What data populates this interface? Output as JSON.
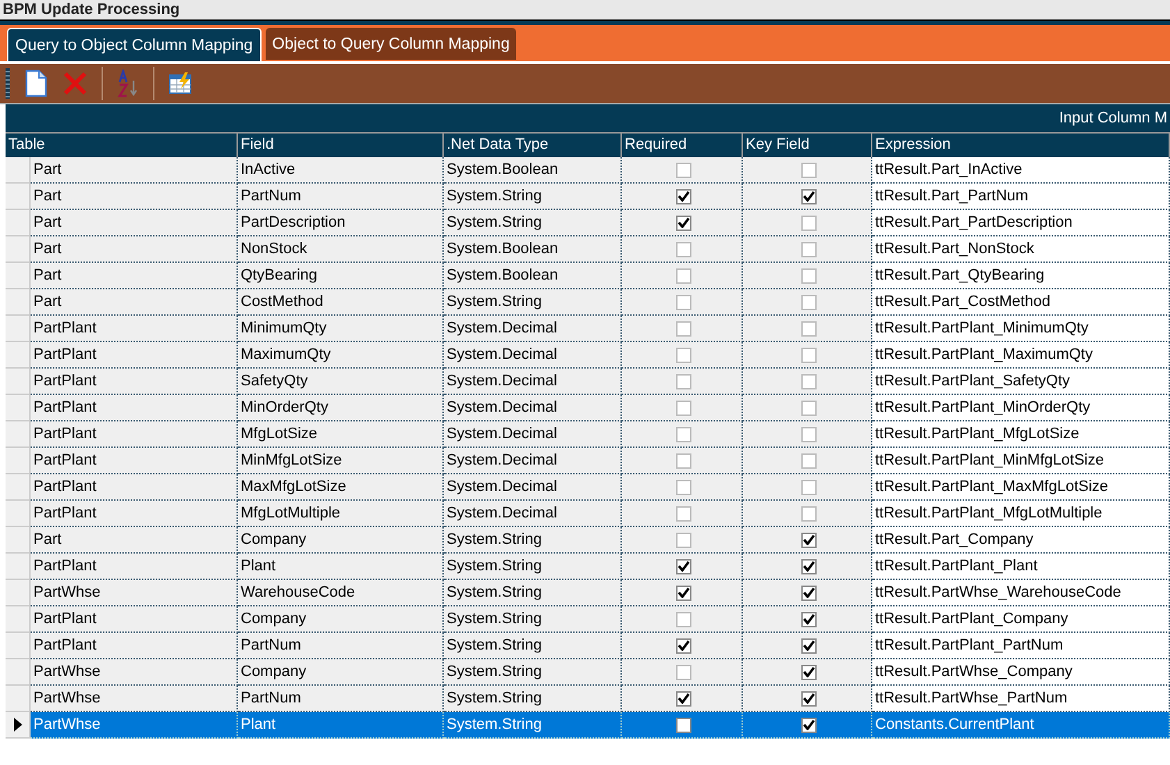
{
  "window": {
    "title": "BPM Update Processing"
  },
  "tabs": [
    {
      "label": "Query to Object Column Mapping",
      "selected": true
    },
    {
      "label": "Object to Query Column Mapping",
      "selected": false
    }
  ],
  "grid": {
    "group_header": "Input Column M",
    "columns": [
      "Table",
      "Field",
      ".Net Data Type",
      "Required",
      "Key Field",
      "Expression"
    ],
    "rows": [
      {
        "table": "Part",
        "field": "InActive",
        "type": "System.Boolean",
        "required": false,
        "key": false,
        "expression": "ttResult.Part_InActive",
        "selected": false
      },
      {
        "table": "Part",
        "field": "PartNum",
        "type": "System.String",
        "required": true,
        "key": true,
        "expression": "ttResult.Part_PartNum",
        "selected": false
      },
      {
        "table": "Part",
        "field": "PartDescription",
        "type": "System.String",
        "required": true,
        "key": false,
        "expression": "ttResult.Part_PartDescription",
        "selected": false
      },
      {
        "table": "Part",
        "field": "NonStock",
        "type": "System.Boolean",
        "required": false,
        "key": false,
        "expression": "ttResult.Part_NonStock",
        "selected": false
      },
      {
        "table": "Part",
        "field": "QtyBearing",
        "type": "System.Boolean",
        "required": false,
        "key": false,
        "expression": "ttResult.Part_QtyBearing",
        "selected": false
      },
      {
        "table": "Part",
        "field": "CostMethod",
        "type": "System.String",
        "required": false,
        "key": false,
        "expression": "ttResult.Part_CostMethod",
        "selected": false
      },
      {
        "table": "PartPlant",
        "field": "MinimumQty",
        "type": "System.Decimal",
        "required": false,
        "key": false,
        "expression": "ttResult.PartPlant_MinimumQty",
        "selected": false
      },
      {
        "table": "PartPlant",
        "field": "MaximumQty",
        "type": "System.Decimal",
        "required": false,
        "key": false,
        "expression": "ttResult.PartPlant_MaximumQty",
        "selected": false
      },
      {
        "table": "PartPlant",
        "field": "SafetyQty",
        "type": "System.Decimal",
        "required": false,
        "key": false,
        "expression": "ttResult.PartPlant_SafetyQty",
        "selected": false
      },
      {
        "table": "PartPlant",
        "field": "MinOrderQty",
        "type": "System.Decimal",
        "required": false,
        "key": false,
        "expression": "ttResult.PartPlant_MinOrderQty",
        "selected": false
      },
      {
        "table": "PartPlant",
        "field": "MfgLotSize",
        "type": "System.Decimal",
        "required": false,
        "key": false,
        "expression": "ttResult.PartPlant_MfgLotSize",
        "selected": false
      },
      {
        "table": "PartPlant",
        "field": "MinMfgLotSize",
        "type": "System.Decimal",
        "required": false,
        "key": false,
        "expression": "ttResult.PartPlant_MinMfgLotSize",
        "selected": false
      },
      {
        "table": "PartPlant",
        "field": "MaxMfgLotSize",
        "type": "System.Decimal",
        "required": false,
        "key": false,
        "expression": "ttResult.PartPlant_MaxMfgLotSize",
        "selected": false
      },
      {
        "table": "PartPlant",
        "field": "MfgLotMultiple",
        "type": "System.Decimal",
        "required": false,
        "key": false,
        "expression": "ttResult.PartPlant_MfgLotMultiple",
        "selected": false
      },
      {
        "table": "Part",
        "field": "Company",
        "type": "System.String",
        "required": false,
        "key": true,
        "expression": "ttResult.Part_Company",
        "selected": false
      },
      {
        "table": "PartPlant",
        "field": "Plant",
        "type": "System.String",
        "required": true,
        "key": true,
        "expression": "ttResult.PartPlant_Plant",
        "selected": false
      },
      {
        "table": "PartWhse",
        "field": "WarehouseCode",
        "type": "System.String",
        "required": true,
        "key": true,
        "expression": "ttResult.PartWhse_WarehouseCode",
        "selected": false
      },
      {
        "table": "PartPlant",
        "field": "Company",
        "type": "System.String",
        "required": false,
        "key": true,
        "expression": "ttResult.PartPlant_Company",
        "selected": false
      },
      {
        "table": "PartPlant",
        "field": "PartNum",
        "type": "System.String",
        "required": true,
        "key": true,
        "expression": "ttResult.PartPlant_PartNum",
        "selected": false
      },
      {
        "table": "PartWhse",
        "field": "Company",
        "type": "System.String",
        "required": false,
        "key": true,
        "expression": "ttResult.PartWhse_Company",
        "selected": false
      },
      {
        "table": "PartWhse",
        "field": "PartNum",
        "type": "System.String",
        "required": true,
        "key": true,
        "expression": "ttResult.PartWhse_PartNum",
        "selected": false
      },
      {
        "table": "PartWhse",
        "field": "Plant",
        "type": "System.String",
        "required": false,
        "key": true,
        "expression": "Constants.CurrentPlant",
        "selected": true
      }
    ]
  }
}
